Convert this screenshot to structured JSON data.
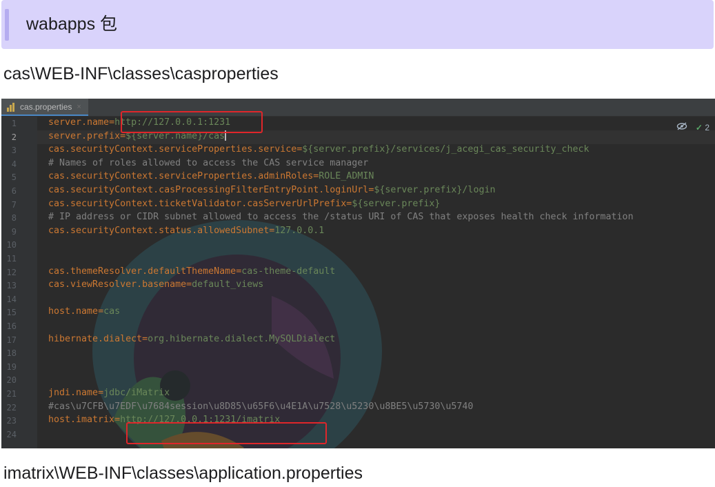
{
  "heading": {
    "text": "wabapps 包"
  },
  "path_top": "cas\\WEB-INF\\classes\\casproperties",
  "path_bottom": "imatrix\\WEB-INF\\classes\\application.properties",
  "editor": {
    "tab_label": "cas.properties",
    "tab_close": "×",
    "inspection_count": "2",
    "current_line": 2,
    "line_numbers": [
      "1",
      "2",
      "3",
      "4",
      "5",
      "6",
      "7",
      "8",
      "9",
      "10",
      "11",
      "12",
      "13",
      "14",
      "15",
      "16",
      "17",
      "18",
      "19",
      "20",
      "21",
      "22",
      "23",
      "24"
    ],
    "lines": [
      {
        "key": "server.name",
        "eq": "=",
        "value": "http://127.0.0.1:1231",
        "comment": ""
      },
      {
        "key": "server.prefix",
        "eq": "=",
        "value": "${server.name}/cas",
        "comment": ""
      },
      {
        "key": "cas.securityContext.serviceProperties.service",
        "eq": "=",
        "value": "${server.prefix}/services/j_acegi_cas_security_check",
        "comment": ""
      },
      {
        "key": "",
        "eq": "",
        "value": "",
        "comment": "# Names of roles allowed to access the CAS service manager"
      },
      {
        "key": "cas.securityContext.serviceProperties.adminRoles",
        "eq": "=",
        "value": "ROLE_ADMIN",
        "comment": ""
      },
      {
        "key": "cas.securityContext.casProcessingFilterEntryPoint.loginUrl",
        "eq": "=",
        "value": "${server.prefix}/login",
        "comment": ""
      },
      {
        "key": "cas.securityContext.ticketValidator.casServerUrlPrefix",
        "eq": "=",
        "value": "${server.prefix}",
        "comment": ""
      },
      {
        "key": "",
        "eq": "",
        "value": "",
        "comment": "# IP address or CIDR subnet allowed to access the /status URI of CAS that exposes health check information"
      },
      {
        "key": "cas.securityContext.status.allowedSubnet",
        "eq": "=",
        "value": "127.0.0.1",
        "comment": ""
      },
      {
        "key": "",
        "eq": "",
        "value": "",
        "comment": ""
      },
      {
        "key": "",
        "eq": "",
        "value": "",
        "comment": ""
      },
      {
        "key": "cas.themeResolver.defaultThemeName",
        "eq": "=",
        "value": "cas-theme-default",
        "comment": ""
      },
      {
        "key": "cas.viewResolver.basename",
        "eq": "=",
        "value": "default_views",
        "comment": ""
      },
      {
        "key": "",
        "eq": "",
        "value": "",
        "comment": ""
      },
      {
        "key": "host.name",
        "eq": "=",
        "value": "cas",
        "comment": ""
      },
      {
        "key": "",
        "eq": "",
        "value": "",
        "comment": ""
      },
      {
        "key": "hibernate.dialect",
        "eq": "=",
        "value": "org.hibernate.dialect.MySQLDialect",
        "comment": ""
      },
      {
        "key": "",
        "eq": "",
        "value": "",
        "comment": ""
      },
      {
        "key": "",
        "eq": "",
        "value": "",
        "comment": ""
      },
      {
        "key": "",
        "eq": "",
        "value": "",
        "comment": ""
      },
      {
        "key": "jndi.name",
        "eq": "=",
        "value": "jdbc/iMatrix",
        "comment": ""
      },
      {
        "key": "",
        "eq": "",
        "value": "",
        "comment": "#cas\\u7CFB\\u7EDF\\u7684session\\u8D85\\u65F6\\u4E1A\\u7528\\u5230\\u8BE5\\u5730\\u5740"
      },
      {
        "key": "host.imatrix",
        "eq": "=",
        "value": "http://127.0.0.1:1231/imatrix",
        "comment": ""
      },
      {
        "key": "",
        "eq": "",
        "value": "",
        "comment": ""
      }
    ]
  },
  "colors": {
    "key": "#cc7832",
    "value": "#6a8759",
    "comment": "#808080",
    "highlight_box": "#e0262a",
    "heading_bg": "#d9d3fb"
  },
  "icons": [
    "properties-file-icon",
    "close-icon",
    "eye-off-icon",
    "check-icon"
  ]
}
